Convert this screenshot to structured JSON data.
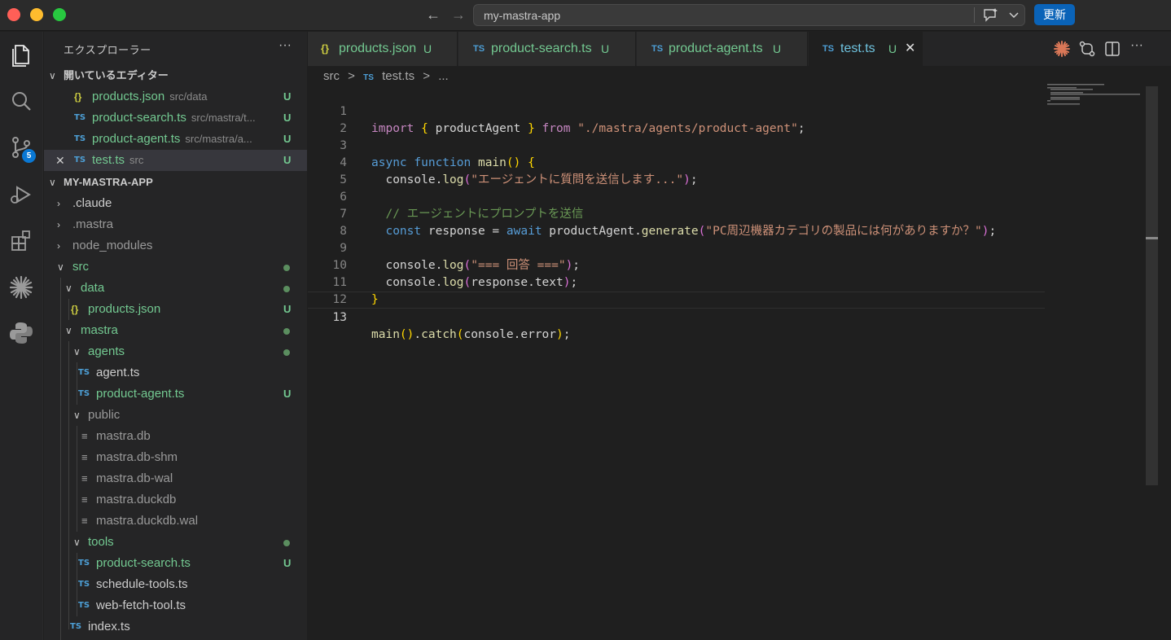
{
  "titlebar": {
    "search_text": "my-mastra-app",
    "update_label": "更新",
    "back_icon": "arrow-left-icon",
    "forward_icon": "arrow-right-icon"
  },
  "activity_bar": {
    "items": [
      "explorer-icon",
      "search-icon",
      "source-control-icon",
      "run-debug-icon",
      "extensions-icon",
      "claude-icon",
      "python-icon"
    ],
    "scm_badge": "5"
  },
  "sidebar": {
    "title": "エクスプローラー",
    "more": "···",
    "open_editors_label": "開いているエディター",
    "open_editors": [
      {
        "icon": "{}",
        "name": "products.json",
        "path": "src/data",
        "status": "U"
      },
      {
        "icon": "TS",
        "name": "product-search.ts",
        "path": "src/mastra/t...",
        "status": "U"
      },
      {
        "icon": "TS",
        "name": "product-agent.ts",
        "path": "src/mastra/a...",
        "status": "U"
      },
      {
        "icon": "TS",
        "name": "test.ts",
        "path": "src",
        "status": "U"
      }
    ],
    "project_label": "MY-MASTRA-APP",
    "tree": {
      "claude": ".claude",
      "mastra_dot": ".mastra",
      "node_modules": "node_modules",
      "src": "src",
      "data": "data",
      "products_json": "products.json",
      "mastra": "mastra",
      "agents": "agents",
      "agent_ts": "agent.ts",
      "product_agent_ts": "product-agent.ts",
      "public": "public",
      "mastra_db": "mastra.db",
      "mastra_db_shm": "mastra.db-shm",
      "mastra_db_wal": "mastra.db-wal",
      "mastra_duckdb": "mastra.duckdb",
      "mastra_duckdb_wal": "mastra.duckdb.wal",
      "tools": "tools",
      "product_search_ts": "product-search.ts",
      "schedule_tools_ts": "schedule-tools.ts",
      "web_fetch_tool_ts": "web-fetch-tool.ts",
      "index_ts": "index.ts"
    },
    "u": "U",
    "ts": "TS",
    "json": "{}"
  },
  "tabs": [
    {
      "icon": "{}",
      "label": "products.json",
      "status": "U"
    },
    {
      "icon": "TS",
      "label": "product-search.ts",
      "status": "U"
    },
    {
      "icon": "TS",
      "label": "product-agent.ts",
      "status": "U"
    },
    {
      "icon": "TS",
      "label": "test.ts",
      "status": "U",
      "active": true
    }
  ],
  "editor": {
    "breadcrumb": {
      "folder": "src",
      "sep": ">",
      "file": "test.ts",
      "more": "..."
    },
    "line_numbers": [
      "1",
      "2",
      "3",
      "4",
      "5",
      "6",
      "7",
      "8",
      "9",
      "10",
      "11",
      "12",
      "13"
    ],
    "tokens": {
      "l1_import": "import",
      "l1_open": "{",
      "l1_name": " productAgent ",
      "l1_close": "}",
      "l1_from": "from",
      "l1_path": "\"./mastra/agents/product-agent\"",
      "l1_end": ";",
      "l3_async": "async",
      "l3_function": "function",
      "l3_main": "main",
      "l3_parens": "()",
      "l3_brace": "{",
      "console": "console",
      "dot": ".",
      "log": "log",
      "l4_str": "\"エージェントに質問を送信します...\"",
      "l6_comment": "// エージェントにプロンプトを送信",
      "l7_const": "const",
      "l7_response": "response",
      "l7_eq": " = ",
      "l7_await": "await",
      "l7_obj": "productAgent",
      "l7_generate": "generate",
      "l7_str": "\"PC周辺機器カテゴリの製品には何がありますか？\"",
      "l9_str": "\"=== 回答 ===\"",
      "l10_resp": "response",
      "l10_text": "text",
      "l11_brace": "}",
      "l13_main": "main",
      "l13_catch": "catch",
      "l13_error": "error",
      "lp": "(",
      "rp": ")",
      "semi": ";",
      "rp_semi": ");"
    }
  },
  "colors": {
    "accent": "#0a63b8",
    "untracked": "#73c991",
    "ts_icon": "#4d9fd6",
    "json_icon": "#cbcb41"
  }
}
